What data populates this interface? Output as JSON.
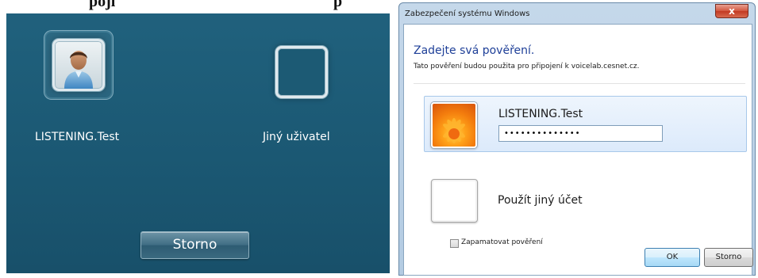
{
  "caption": {
    "fragment_left": "pojí",
    "fragment_right": "p"
  },
  "logon_screen": {
    "users": [
      {
        "name": "LISTENING.Test",
        "icon": "user-avatar-icon",
        "selected": true
      },
      {
        "name": "Jiný uživatel",
        "icon": "blank-tile",
        "selected": false
      }
    ],
    "cancel_label": "Storno"
  },
  "dialog": {
    "title": "Zabezpečení systému Windows",
    "close_glyph": "x",
    "heading": "Zadejte svá pověření.",
    "subheading": "Tato pověření budou použita pro připojení k voicelab.cesnet.cz.",
    "credential": {
      "user": "LISTENING.Test",
      "password_mask": "••••••••••••••"
    },
    "other_account_label": "Použít jiný účet",
    "remember_label": "Zapamatovat pověření",
    "remember_checked": false,
    "ok_label": "OK",
    "cancel_label": "Storno"
  },
  "colors": {
    "logon_background": "#1b5873",
    "dialog_heading": "#1e3f98",
    "selected_row": "#dceafb"
  }
}
